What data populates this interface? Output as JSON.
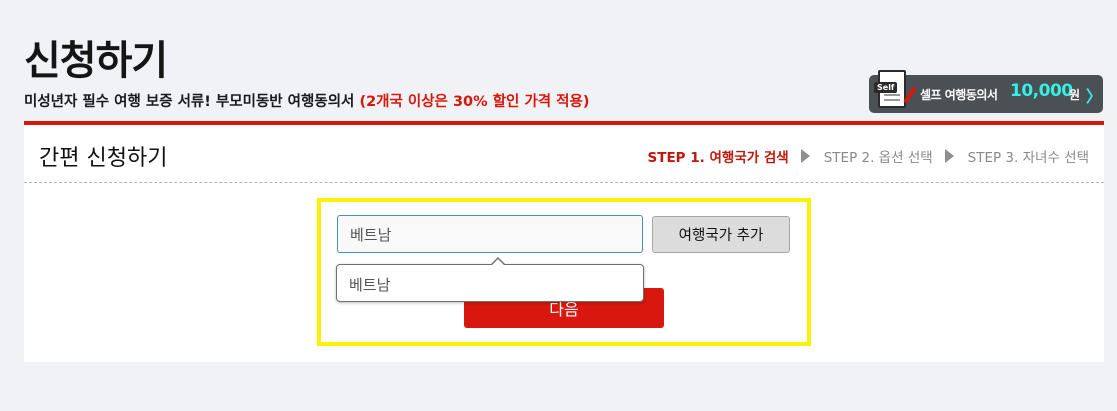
{
  "header": {
    "title": "신청하기",
    "subtitle_main": "미성년자 필수 여행 보증 서류! 부모미동반 여행동의서 ",
    "subtitle_highlight": "(2개국 이상은 30% 할인 가격 적용)"
  },
  "promo": {
    "badge": "Self",
    "label": "셀프 여행동의서",
    "price": "10,000",
    "unit": "원",
    "chevron": "〉",
    "icon": "document-pen-icon"
  },
  "section": {
    "title": "간편 신청하기"
  },
  "steps": [
    {
      "label": "STEP 1. 여행국가 검색",
      "active": true
    },
    {
      "label": "STEP 2. 옵션 선택",
      "active": false
    },
    {
      "label": "STEP 3. 자녀수 선택",
      "active": false
    }
  ],
  "form": {
    "country_value": "베트남",
    "add_button_label": "여행국가 추가",
    "next_button_label": "다음",
    "suggestion": "베트남"
  },
  "colors": {
    "accent_red": "#d6170c",
    "highlight_yellow": "#f9f201",
    "promo_cyan": "#35f0e4"
  }
}
